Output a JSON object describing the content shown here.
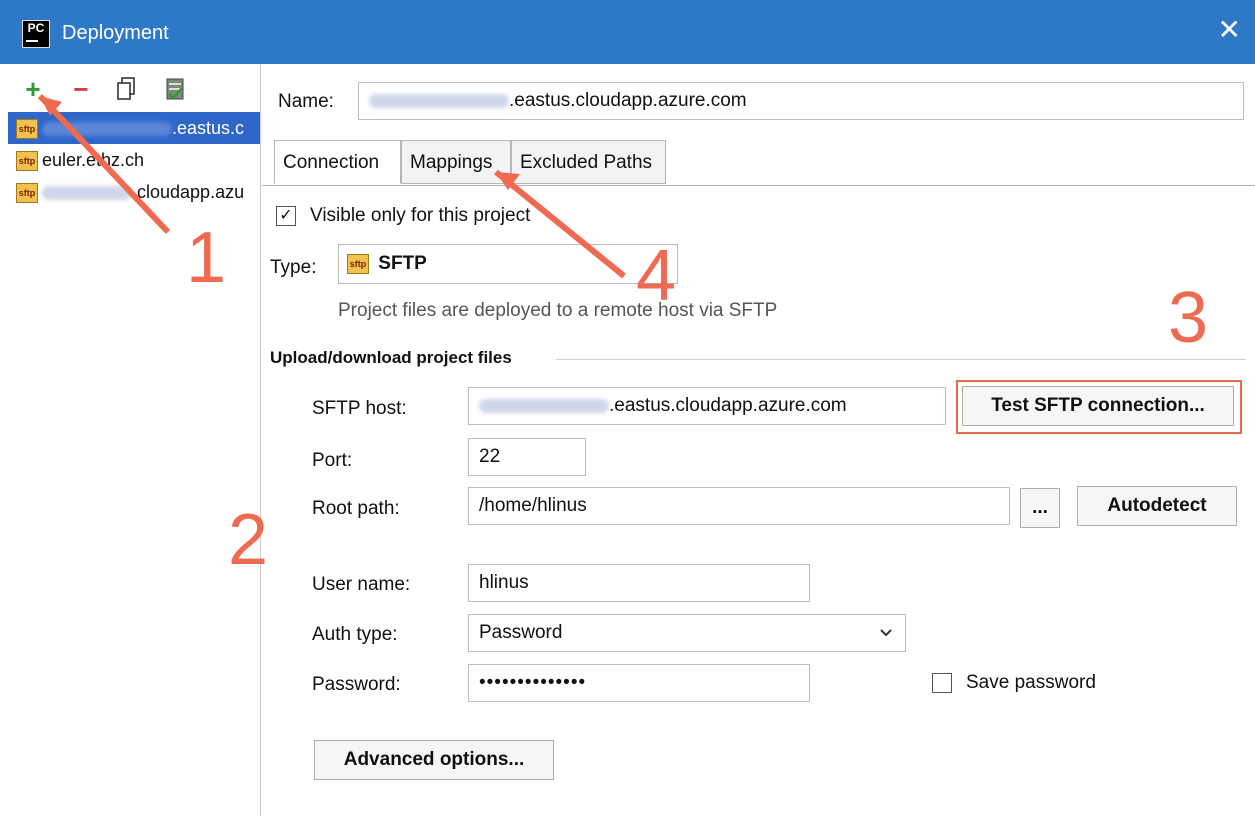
{
  "window": {
    "title": "Deployment",
    "app_icon_text": "PC",
    "close_glyph": "✕"
  },
  "toolbar": {
    "add_glyph": "+",
    "remove_glyph": "−",
    "copy_icon": "copy-icon",
    "default_icon": "set-default-icon"
  },
  "servers": [
    {
      "suffix": ".eastus.c",
      "selected": true
    },
    {
      "suffix": "euler.ethz.ch",
      "selected": false
    },
    {
      "suffix": ".cloudapp.azu",
      "selected": false
    }
  ],
  "name_label": "Name:",
  "name_value": ".eastus.cloudapp.azure.com",
  "tabs": [
    {
      "label": "Connection",
      "active": true
    },
    {
      "label": "Mappings",
      "active": false
    },
    {
      "label": "Excluded Paths",
      "active": false
    }
  ],
  "visible_only": {
    "label": "Visible only for this project",
    "checked": true
  },
  "type": {
    "label": "Type:",
    "value": "SFTP",
    "icon_text": "sftp"
  },
  "type_description": "Project files are deployed to a remote host via SFTP",
  "section_title": "Upload/download project files",
  "sftp_host": {
    "label": "SFTP host:",
    "value": ".eastus.cloudapp.azure.com"
  },
  "test_button": "Test SFTP connection...",
  "port": {
    "label": "Port:",
    "value": "22"
  },
  "root_path": {
    "label": "Root path:",
    "value": "/home/hlinus"
  },
  "browse_button": "...",
  "autodetect_button": "Autodetect",
  "user_name": {
    "label": "User name:",
    "value": "hlinus"
  },
  "auth_type": {
    "label": "Auth type:",
    "value": "Password"
  },
  "password": {
    "label": "Password:",
    "value": "••••••••••••••"
  },
  "save_password": {
    "label": "Save password",
    "checked": false
  },
  "advanced_button": "Advanced options...",
  "annotations": [
    "1",
    "2",
    "3",
    "4"
  ],
  "colors": {
    "titlebar": "#2d79c8",
    "selection": "#2f66c9",
    "annotation": "#ef6a50"
  }
}
